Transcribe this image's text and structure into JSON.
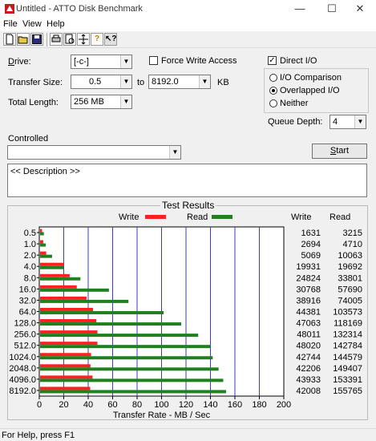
{
  "window": {
    "title": "Untitled - ATTO Disk Benchmark",
    "min_glyph": "—",
    "max_glyph": "☐",
    "close_glyph": "✕"
  },
  "menu": [
    "File",
    "View",
    "Help"
  ],
  "toolbar": {
    "icons": [
      "new-file-icon",
      "open-folder-icon",
      "save-icon",
      "print-icon",
      "print-preview-icon",
      "move-icon",
      "help-icon",
      "context-help-icon"
    ]
  },
  "form": {
    "drive_label": "Drive:",
    "drive_value": "[-c-]",
    "force_write_label": "Force Write Access",
    "force_write_checked": false,
    "direct_io_label": "Direct I/O",
    "direct_io_checked": true,
    "transfer_size_label": "Transfer Size:",
    "transfer_from": "0.5",
    "to_label": "to",
    "transfer_to": "8192.0",
    "kb_label": "KB",
    "total_length_label": "Total Length:",
    "total_length": "256 MB",
    "radio_options": [
      {
        "label": "I/O Comparison",
        "selected": false
      },
      {
        "label": "Overlapped I/O",
        "selected": true
      },
      {
        "label": "Neither",
        "selected": false
      }
    ],
    "queue_depth_label": "Queue Depth:",
    "queue_depth": "4",
    "controlled_label": "Controlled",
    "controlled_value": "",
    "start_label": "Start",
    "description": "<< Description >>"
  },
  "results": {
    "title": "Test Results",
    "write_legend": "Write",
    "read_legend": "Read",
    "col_write": "Write",
    "col_read": "Read"
  },
  "chart_data": {
    "type": "bar",
    "title": "Test Results",
    "xlabel": "Transfer Rate - MB / Sec",
    "xlim": [
      0,
      200
    ],
    "xticks": [
      "0",
      "20",
      "40",
      "60",
      "80",
      "100",
      "120",
      "140",
      "160",
      "180",
      "200"
    ],
    "categories": [
      "0.5",
      "1.0",
      "2.0",
      "4.0",
      "8.0",
      "16.0",
      "32.0",
      "64.0",
      "128.0",
      "256.0",
      "512.0",
      "1024.0",
      "2048.0",
      "4096.0",
      "8192.0"
    ],
    "series": [
      {
        "name": "Write",
        "color": "#ff2020",
        "values": [
          1.6,
          2.6,
          5.0,
          19.5,
          24.2,
          30.0,
          38.0,
          43.3,
          46.0,
          46.9,
          46.9,
          41.7,
          41.2,
          42.9,
          41.0
        ],
        "labels": [
          "1631",
          "2694",
          "5069",
          "19931",
          "24824",
          "30768",
          "38916",
          "44381",
          "47063",
          "48011",
          "48020",
          "42744",
          "42206",
          "43933",
          "42008"
        ]
      },
      {
        "name": "Read",
        "color": "#208020",
        "values": [
          3.1,
          4.6,
          9.8,
          19.2,
          33.0,
          56.3,
          72.3,
          101.1,
          115.4,
          129.3,
          139.4,
          141.2,
          146.0,
          149.8,
          152.1
        ],
        "labels": [
          "3215",
          "4710",
          "10063",
          "19692",
          "33801",
          "57690",
          "74005",
          "103573",
          "118169",
          "132314",
          "142784",
          "144579",
          "149407",
          "153391",
          "155765"
        ]
      }
    ],
    "grid": true,
    "legend": "top"
  },
  "status": {
    "text": "For Help, press F1"
  }
}
